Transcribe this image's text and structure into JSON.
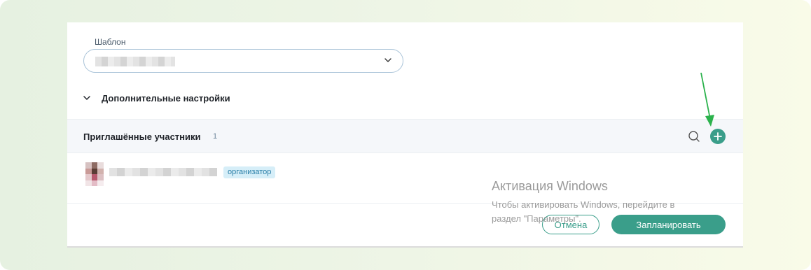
{
  "template": {
    "label": "Шаблон",
    "selected_value": ""
  },
  "advanced": {
    "label": "Дополнительные настройки"
  },
  "participants": {
    "title": "Приглашённые участники",
    "count": "1",
    "items": [
      {
        "name": "",
        "role_badge": "организатор"
      }
    ]
  },
  "actions": {
    "cancel_label": "Отмена",
    "schedule_label": "Запланировать"
  },
  "watermark": {
    "title": "Активация Windows",
    "line1": "Чтобы активировать Windows, перейдите в",
    "line2": "раздел \"Параметры\"."
  },
  "icons": {
    "select_chevron": "chevron-down-icon",
    "advanced_toggle": "chevron-down-icon",
    "search": "search-icon",
    "add": "plus-icon",
    "annotation_arrow": "arrow-icon"
  },
  "colors": {
    "accent": "#3a9e8a",
    "badge_bg": "#d6eef8",
    "badge_text": "#2a7fa8",
    "annotation_arrow": "#2bb24c"
  }
}
